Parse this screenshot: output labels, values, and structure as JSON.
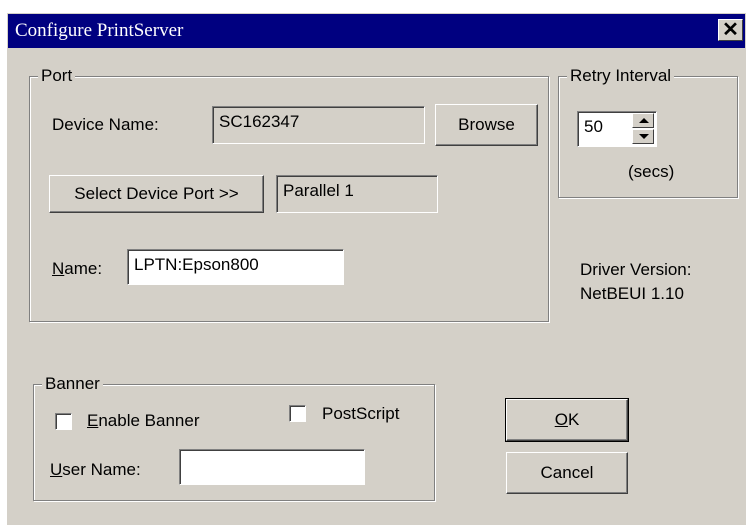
{
  "window": {
    "title": "Configure PrintServer",
    "close_label": "✕"
  },
  "port": {
    "legend": "Port",
    "device_name_label": "Device Name:",
    "device_name_value": "SC162347",
    "browse_label": "Browse",
    "select_port_label": "Select Device Port >>",
    "port_value": "Parallel 1",
    "name_label_first": "N",
    "name_label_rest": "ame:",
    "name_value": "LPTN:Epson800"
  },
  "retry": {
    "legend": "Retry Interval",
    "value": "50",
    "unit": "(secs)"
  },
  "driver": {
    "line1": "Driver Version:",
    "line2": "NetBEUI  1.10"
  },
  "banner": {
    "legend": "Banner",
    "enable_first": "E",
    "enable_rest": "nable Banner",
    "enable_checked": false,
    "postscript_label": "PostScript",
    "postscript_checked": false,
    "user_first": "U",
    "user_rest": "ser Name:",
    "user_value": ""
  },
  "buttons": {
    "ok_first": "O",
    "ok_rest": "K",
    "cancel_label": "Cancel"
  }
}
